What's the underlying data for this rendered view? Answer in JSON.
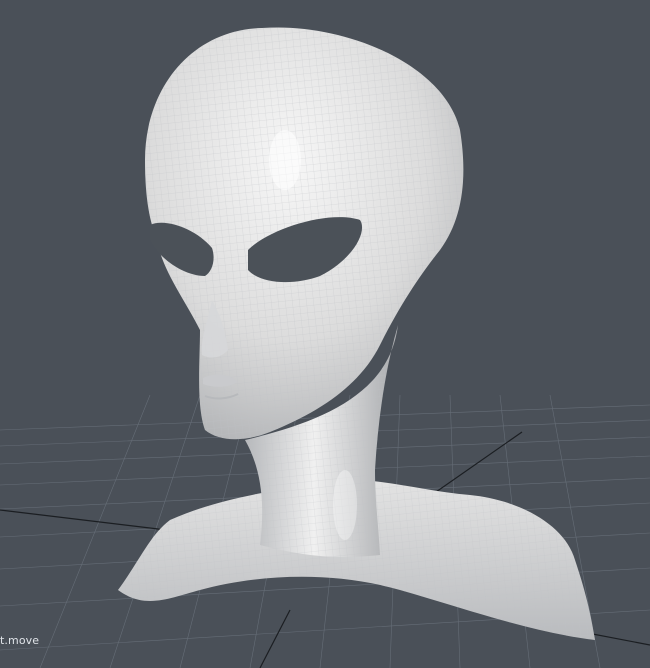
{
  "viewport": {
    "background_color": "#4a5058",
    "grid_color": "#6b737d",
    "axis_color": "#1b1e22",
    "model_color": "#e6e6e6",
    "wire_color": "#c7c9cc",
    "eye_color": "#4b5158"
  },
  "model": {
    "icon": "alien-bust-mesh"
  },
  "status": {
    "tool_label": "t.move"
  }
}
